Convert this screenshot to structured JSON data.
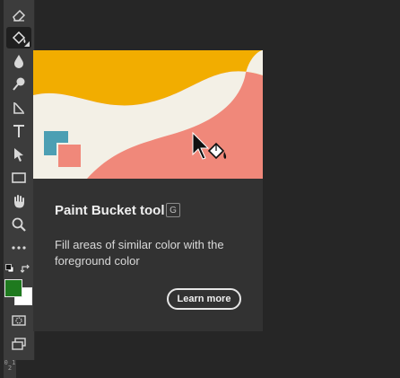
{
  "toolbar": {
    "tools": [
      {
        "name": "eraser-tool",
        "icon": "eraser-icon"
      },
      {
        "name": "paint-bucket-tool",
        "icon": "paint-bucket-icon",
        "active": true
      },
      {
        "name": "blur-tool",
        "icon": "drop-icon"
      },
      {
        "name": "dodge-tool",
        "icon": "dodge-icon"
      },
      {
        "name": "pen-tool",
        "icon": "pen-icon"
      },
      {
        "name": "type-tool",
        "icon": "type-icon"
      },
      {
        "name": "path-selection-tool",
        "icon": "arrow-icon"
      },
      {
        "name": "rectangle-tool",
        "icon": "rectangle-icon"
      },
      {
        "name": "hand-tool",
        "icon": "hand-icon"
      },
      {
        "name": "zoom-tool",
        "icon": "magnifier-icon"
      },
      {
        "name": "more-tools",
        "icon": "ellipsis-icon"
      }
    ],
    "foreground_color": "#1f7a1f",
    "background_color": "#ffffff",
    "ruler_text": "0 1 2"
  },
  "tooltip": {
    "title": "Paint Bucket tool",
    "shortcut": "G",
    "description": "Fill areas of similar color with the foreground color",
    "learn_more": "Learn more",
    "art_colors": {
      "yellow": "#f2ad00",
      "cream": "#f3f0e6",
      "salmon": "#f0887a",
      "teal": "#4c9fb3"
    }
  }
}
